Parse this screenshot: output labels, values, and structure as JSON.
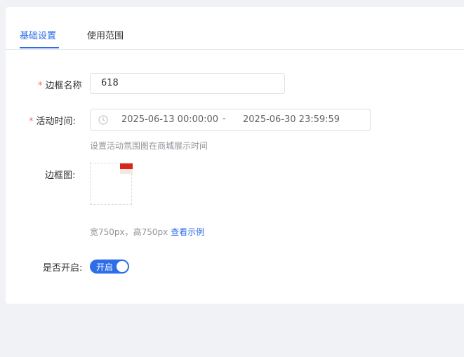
{
  "tabs": [
    {
      "label": "基础设置",
      "active": true
    },
    {
      "label": "使用范围",
      "active": false
    }
  ],
  "form": {
    "required_mark": "*",
    "border_name": {
      "label": "边框名称",
      "value": "618"
    },
    "activity_time": {
      "label": "活动时间:",
      "start": "2025-06-13 00:00:00",
      "separator": "-",
      "end": "2025-06-30 23:59:59",
      "hint": "设置活动氛围图在商城展示时间",
      "icon": "clock-icon"
    },
    "border_image": {
      "label": "边框图:",
      "size_hint": "宽750px，高750px",
      "example_link": "查看示例"
    },
    "enabled": {
      "label": "是否开启:",
      "switch_text": "开启",
      "on": true
    }
  },
  "colors": {
    "accent": "#2d6de8",
    "required": "#f56c6c",
    "background": "#f0f2f5"
  }
}
